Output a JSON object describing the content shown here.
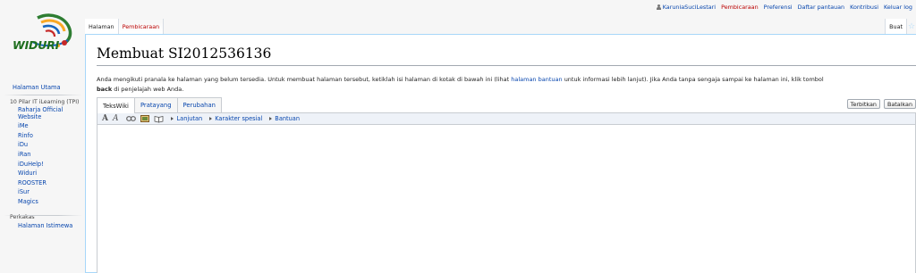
{
  "personal": {
    "username": "KaruniaSuciLestari",
    "talk": "Pembicaraan",
    "preferences": "Preferensi",
    "watchlist": "Daftar pantauan",
    "contributions": "Kontribusi",
    "logout": "Keluar log"
  },
  "logo": {
    "wordmark": "WIDURI"
  },
  "tabs": {
    "page": "Halaman",
    "talk": "Pembicaraan",
    "create": "Buat"
  },
  "sidebar": {
    "main_page": "Halaman Utama",
    "portal_heading": "10 Pilar IT iLearning (TPI)",
    "portal_items": [
      "Raharja Official Website",
      "iMe",
      "Rinfo",
      "iDu",
      "iRan",
      "iDuHelp!",
      "Widuri",
      "ROOSTER",
      "iSur",
      "Magics"
    ],
    "tools_heading": "Perkakas",
    "tools_items": [
      "Halaman Istimewa"
    ]
  },
  "page": {
    "heading": "Membuat SI2012536136",
    "intro_pre": "Anda mengikuti pranala ke halaman yang belum tersedia. Untuk membuat halaman tersebut, ketiklah isi halaman di kotak di bawah ini (lihat ",
    "intro_link": "halaman bantuan",
    "intro_mid": " untuk informasi lebih lanjut). Jika Anda tanpa sengaja sampai ke halaman ini, klik tombol ",
    "intro_bold": "back",
    "intro_post": " di penjelajah web Anda."
  },
  "editor": {
    "tabs": [
      "TeksWiki",
      "Pratayang",
      "Perubahan"
    ],
    "publish": "Terbitkan",
    "cancel": "Batalkan",
    "toolbar": {
      "bold": "A",
      "italic": "A",
      "advanced": "Lanjutan",
      "special_chars": "Karakter spesial",
      "help": "Bantuan"
    }
  }
}
